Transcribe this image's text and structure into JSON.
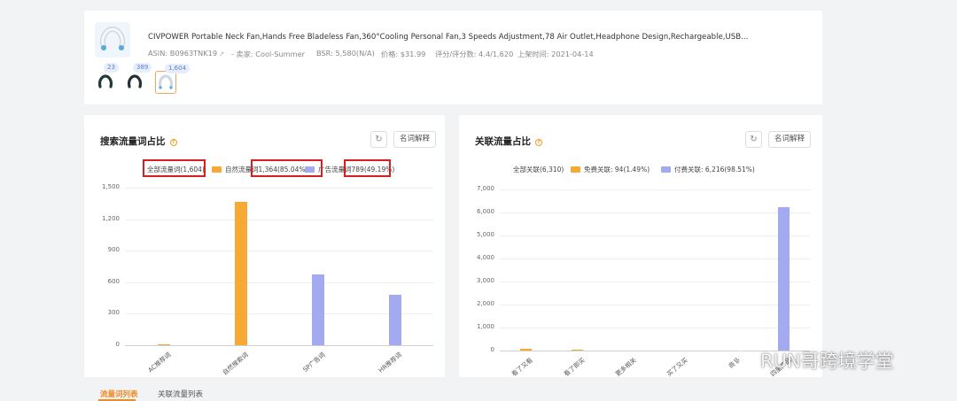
{
  "product": {
    "title": "CIVPOWER Portable Neck Fan,Hands Free Bladeless Fan,360°Cooling Personal Fan,3 Speeds Adjustment,78 Air Outlet,Headphone Design,Rechargeable,USB...",
    "asin": "ASIN: B0963TNK19",
    "seller": "- 卖家: Cool-Summer",
    "bsr": "BSR: 5,580(N/A)",
    "price": "价格: $31.99",
    "rating": "评分/评分数: 4.4/1,620",
    "listed": "上架时间: 2021-04-14",
    "variants": [
      {
        "badge": "23",
        "icon": "neck-fan-dark-icon"
      },
      {
        "badge": "389",
        "icon": "neck-fan-dark-icon"
      },
      {
        "badge": "1,604",
        "icon": "neck-fan-white-icon"
      }
    ]
  },
  "left_panel": {
    "title": "搜索流量词占比",
    "refresh_icon": "refresh-icon",
    "explain_label": "名词解释",
    "legend": [
      {
        "label": "全部流量词(1,604)",
        "color": ""
      },
      {
        "label": "自然流量词1,364(85.04%)",
        "color": "#f7a935"
      },
      {
        "label": "广告流量词789(49.19%)",
        "color": "#a3aaf0"
      }
    ]
  },
  "right_panel": {
    "title": "关联流量占比",
    "refresh_icon": "refresh-icon",
    "explain_label": "名词解释",
    "legend": [
      {
        "label": "全部关联(6,310)",
        "color": ""
      },
      {
        "label": "免费关联: 94(1.49%)",
        "color": "#f7a935"
      },
      {
        "label": "付费关联: 6,216(98.51%)",
        "color": "#a3aaf0"
      }
    ]
  },
  "chart_data": [
    {
      "type": "bar",
      "title": "搜索流量词占比",
      "categories": [
        "AC推荐词",
        "自然搜索词",
        "SP广告词",
        "HR推荐词"
      ],
      "values": [
        8,
        1364,
        670,
        478
      ],
      "colors": [
        "#f7a935",
        "#f7a935",
        "#a3aaf0",
        "#a3aaf0"
      ],
      "yticks": [
        "1,500",
        "1,200",
        "900",
        "600",
        "300",
        "0"
      ],
      "ylim": [
        0,
        1500
      ],
      "grid": true
    },
    {
      "type": "bar",
      "title": "关联流量占比",
      "categories": [
        "看了又看",
        "看了即买",
        "更多相关",
        "买了又买",
        "商品",
        "四星产品"
      ],
      "values": [
        90,
        4,
        0,
        0,
        0,
        6216
      ],
      "colors": [
        "#f7a935",
        "#f7a935",
        "#f7a935",
        "#f7a935",
        "#f7a935",
        "#a3aaf0"
      ],
      "yticks": [
        "7,000",
        "6,000",
        "5,000",
        "4,000",
        "3,000",
        "2,000",
        "1,000",
        "0"
      ],
      "ylim": [
        0,
        7000
      ],
      "grid": true
    }
  ],
  "tabs": [
    {
      "label": "流量词列表",
      "active": true
    },
    {
      "label": "关联流量列表",
      "active": false
    }
  ],
  "watermark": {
    "text": "RUN哥跨境学堂",
    "icon": "wechat-icon"
  }
}
